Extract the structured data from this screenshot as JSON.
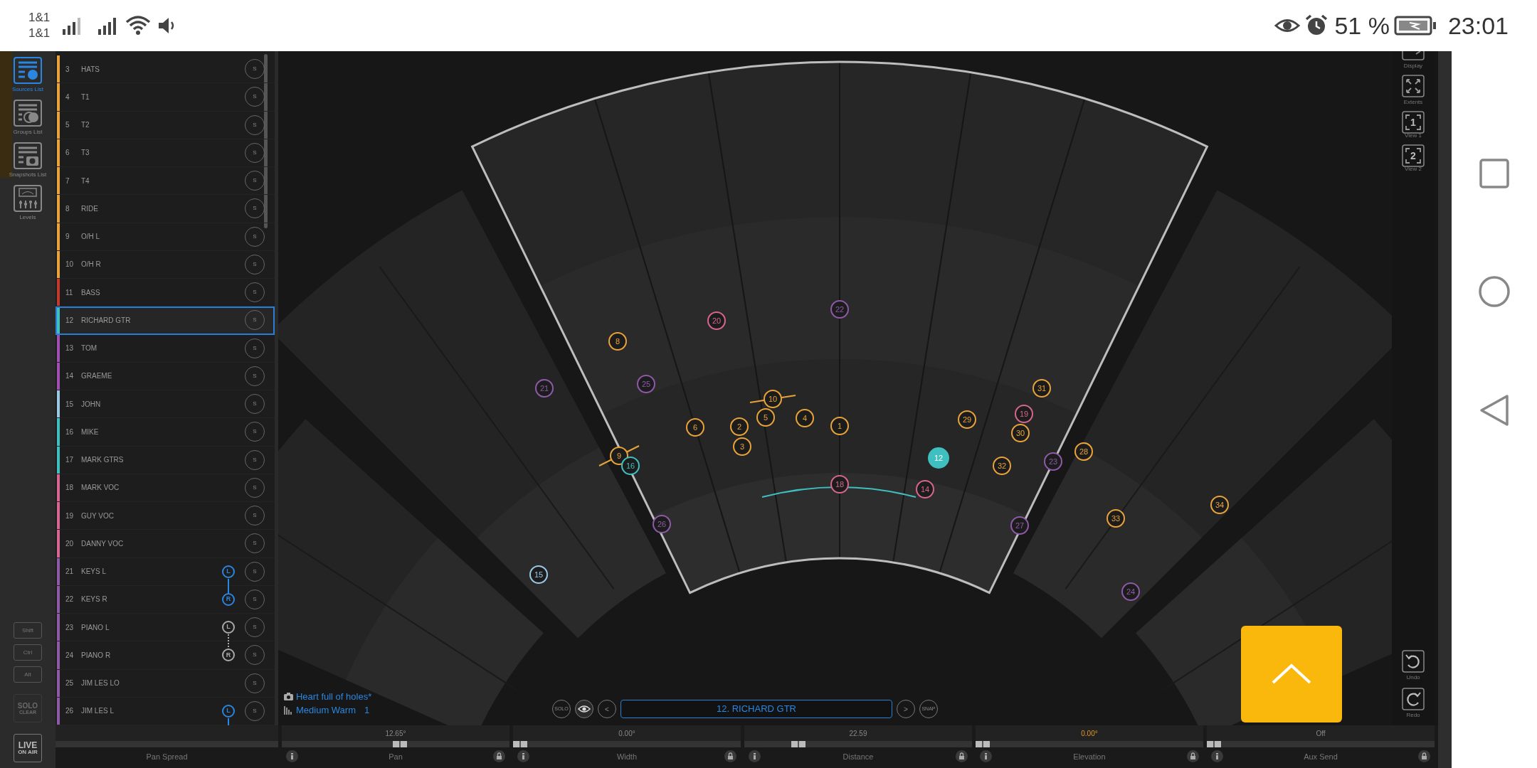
{
  "status_bar": {
    "carriers": [
      "1&1",
      "1&1"
    ],
    "battery": "51 %",
    "time": "23:01"
  },
  "toolbar": {
    "views": [
      {
        "label": "Sources List",
        "kind": "sources",
        "selected": true
      },
      {
        "label": "Groups List",
        "kind": "groups",
        "selected": false
      },
      {
        "label": "Snapshots List",
        "kind": "snapshots",
        "selected": false
      },
      {
        "label": "Levels",
        "kind": "levels",
        "selected": false
      }
    ],
    "modifiers": [
      "Shift",
      "Ctrl",
      "Alt"
    ],
    "solo_clear": {
      "top": "SOLO",
      "bottom": "CLEAR",
      "disabled": true
    },
    "live": {
      "top": "LIVE",
      "bottom": "ON AIR"
    }
  },
  "sources": [
    {
      "number": "3",
      "name": "HATS",
      "color": "#e8a33a",
      "selected": false,
      "solo": "S"
    },
    {
      "number": "4",
      "name": "T1",
      "color": "#e8a33a",
      "selected": false,
      "solo": "S"
    },
    {
      "number": "5",
      "name": "T2",
      "color": "#e8a33a",
      "selected": false,
      "solo": "S"
    },
    {
      "number": "6",
      "name": "T3",
      "color": "#e8a33a",
      "selected": false,
      "solo": "S"
    },
    {
      "number": "7",
      "name": "T4",
      "color": "#e8a33a",
      "selected": false,
      "solo": "S"
    },
    {
      "number": "8",
      "name": "RIDE",
      "color": "#e8a33a",
      "selected": false,
      "solo": "S"
    },
    {
      "number": "9",
      "name": "O/H L",
      "color": "#e8a33a",
      "selected": false,
      "solo": "S"
    },
    {
      "number": "10",
      "name": "O/H R",
      "color": "#e8a33a",
      "selected": false,
      "solo": "S"
    },
    {
      "number": "11",
      "name": "BASS",
      "color": "#c0392b",
      "selected": false,
      "solo": "S"
    },
    {
      "number": "12",
      "name": "RICHARD GTR",
      "color": "#3fbfbf",
      "selected": true,
      "solo": "S"
    },
    {
      "number": "13",
      "name": "TOM",
      "color": "#a050b0",
      "selected": false,
      "solo": "S"
    },
    {
      "number": "14",
      "name": "GRAEME",
      "color": "#a050b0",
      "selected": false,
      "solo": "S"
    },
    {
      "number": "15",
      "name": "JOHN",
      "color": "#9cc8e8",
      "selected": false,
      "solo": "S"
    },
    {
      "number": "16",
      "name": "MIKE",
      "color": "#3fbfbf",
      "selected": false,
      "solo": "S"
    },
    {
      "number": "17",
      "name": "MARK GTRS",
      "color": "#3fbfbf",
      "selected": false,
      "solo": "S"
    },
    {
      "number": "18",
      "name": "MARK VOC",
      "color": "#d6668f",
      "selected": false,
      "solo": "S"
    },
    {
      "number": "19",
      "name": "GUY VOC",
      "color": "#d6668f",
      "selected": false,
      "solo": "S"
    },
    {
      "number": "20",
      "name": "DANNY VOC",
      "color": "#d6668f",
      "selected": false,
      "solo": "S"
    },
    {
      "number": "21",
      "name": "KEYS L",
      "color": "#8e5aa8",
      "selected": false,
      "solo": "S",
      "link": {
        "text": "L",
        "kind": "start",
        "linked": true
      }
    },
    {
      "number": "22",
      "name": "KEYS R",
      "color": "#8e5aa8",
      "selected": false,
      "solo": "S",
      "link": {
        "text": "R",
        "kind": "end",
        "linked": true
      }
    },
    {
      "number": "23",
      "name": "PIANO L",
      "color": "#8e5aa8",
      "selected": false,
      "solo": "S",
      "link": {
        "text": "L",
        "kind": "start",
        "linked": false
      }
    },
    {
      "number": "24",
      "name": "PIANO R",
      "color": "#8e5aa8",
      "selected": false,
      "solo": "S",
      "link": {
        "text": "R",
        "kind": "end",
        "linked": false
      }
    },
    {
      "number": "25",
      "name": "JIM LES LO",
      "color": "#8e5aa8",
      "selected": false,
      "solo": "S"
    },
    {
      "number": "26",
      "name": "JIM LES L",
      "color": "#8e5aa8",
      "selected": false,
      "solo": "S",
      "link": {
        "text": "L",
        "kind": "start",
        "linked": true
      }
    }
  ],
  "stage": {
    "nodes": [
      {
        "label": "22",
        "color": "#8e5aa8",
        "selected": false
      },
      {
        "label": "20",
        "color": "#d6668f",
        "selected": false
      },
      {
        "label": "8",
        "color": "#e8a33a",
        "selected": false
      },
      {
        "label": "21",
        "color": "#8e5aa8",
        "selected": false
      },
      {
        "label": "25",
        "color": "#8e5aa8",
        "selected": false
      },
      {
        "label": "10",
        "color": "#e8a33a",
        "selected": false
      },
      {
        "label": "6",
        "color": "#e8a33a",
        "selected": false
      },
      {
        "label": "2",
        "color": "#e8a33a",
        "selected": false
      },
      {
        "label": "5",
        "color": "#e8a33a",
        "selected": false
      },
      {
        "label": "4",
        "color": "#e8a33a",
        "selected": false
      },
      {
        "label": "1",
        "color": "#e8a33a",
        "selected": false
      },
      {
        "label": "3",
        "color": "#e8a33a",
        "selected": false
      },
      {
        "label": "9",
        "color": "#e8a33a",
        "selected": false
      },
      {
        "label": "16",
        "color": "#3fbfbf",
        "selected": false
      },
      {
        "label": "18",
        "color": "#d6668f",
        "selected": false
      },
      {
        "label": "14",
        "color": "#d6668f",
        "selected": false
      },
      {
        "label": "12",
        "color": "#3fbfbf",
        "selected": true
      },
      {
        "label": "29",
        "color": "#e8a33a",
        "selected": false
      },
      {
        "label": "31",
        "color": "#e8a33a",
        "selected": false
      },
      {
        "label": "19",
        "color": "#d6668f",
        "selected": false
      },
      {
        "label": "30",
        "color": "#e8a33a",
        "selected": false
      },
      {
        "label": "32",
        "color": "#e8a33a",
        "selected": false
      },
      {
        "label": "23",
        "color": "#8e5aa8",
        "selected": false
      },
      {
        "label": "28",
        "color": "#e8a33a",
        "selected": false
      },
      {
        "label": "26",
        "color": "#8e5aa8",
        "selected": false
      },
      {
        "label": "27",
        "color": "#8e5aa8",
        "selected": false
      },
      {
        "label": "33",
        "color": "#e8a33a",
        "selected": false
      },
      {
        "label": "34",
        "color": "#e8a33a",
        "selected": false
      },
      {
        "label": "15",
        "color": "#9cc8e8",
        "selected": false
      },
      {
        "label": "24",
        "color": "#8e5aa8",
        "selected": false
      }
    ]
  },
  "view_tools": [
    {
      "label": "Display",
      "kind": "display"
    },
    {
      "label": "Extents",
      "kind": "extents"
    },
    {
      "label": "View 1",
      "kind": "view",
      "glyph": "1"
    },
    {
      "label": "View 2",
      "kind": "view",
      "glyph": "2"
    }
  ],
  "history": [
    {
      "label": "Undo",
      "kind": "undo"
    },
    {
      "label": "Redo",
      "kind": "redo"
    }
  ],
  "snapshot": {
    "name": "Heart full of holes*",
    "preset": "Medium Warm",
    "preset_number": "1"
  },
  "selector": {
    "solo": "SOLO",
    "prev": "<",
    "current": "12. RICHARD GTR",
    "next": ">",
    "snap": "SNAP"
  },
  "parameters": [
    {
      "label": "Pan Spread",
      "kind": "plain"
    },
    {
      "label": "Pan",
      "kind": "full",
      "value": "12.65°",
      "level": 0.52,
      "highlight": false
    },
    {
      "label": "Width",
      "kind": "full",
      "value": "0.00°",
      "level": 0,
      "highlight": false
    },
    {
      "label": "Distance",
      "kind": "full",
      "value": "22.59",
      "level": 0.22,
      "highlight": false
    },
    {
      "label": "Elevation",
      "kind": "full",
      "value": "0.00°",
      "level": 0,
      "highlight": true
    },
    {
      "label": "Aux Send",
      "kind": "full",
      "value": "Off",
      "level": 0,
      "highlight": false
    }
  ]
}
